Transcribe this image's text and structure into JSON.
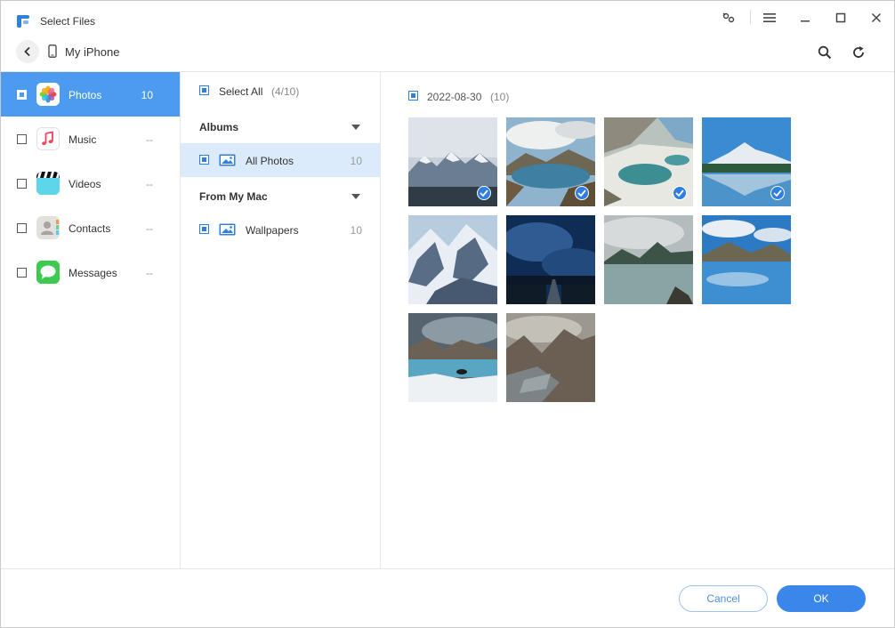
{
  "window": {
    "title": "Select Files"
  },
  "nav": {
    "device_name": "My iPhone"
  },
  "icons": {
    "app": "app-logo-icon",
    "connect": "connect-icon",
    "menu": "menu-icon",
    "minimize": "minimize-icon",
    "maximize": "maximize-icon",
    "close": "close-icon",
    "back": "chevron-left-icon",
    "device": "phone-icon",
    "search": "search-icon",
    "refresh": "refresh-icon"
  },
  "categories": [
    {
      "label": "Photos",
      "count": "10",
      "active": true
    },
    {
      "label": "Music",
      "count": "--"
    },
    {
      "label": "Videos",
      "count": "--"
    },
    {
      "label": "Contacts",
      "count": "--"
    },
    {
      "label": "Messages",
      "count": "--"
    }
  ],
  "middle": {
    "select_all_label": "Select All",
    "select_all_count": "(4/10)",
    "albums_title": "Albums",
    "all_photos_label": "All Photos",
    "all_photos_count": "10",
    "from_mac_title": "From My Mac",
    "wallpapers_label": "Wallpapers",
    "wallpapers_count": "10"
  },
  "photos": {
    "date_label": "2022-08-30",
    "date_count": "(10)",
    "selected": [
      true,
      true,
      true,
      true,
      false,
      false,
      false,
      false,
      false,
      false
    ]
  },
  "footer": {
    "cancel_label": "Cancel",
    "ok_label": "OK"
  },
  "colors": {
    "accent": "#3a86eb",
    "active_row": "#4c9bf0",
    "selected_album": "#dcebfb"
  }
}
